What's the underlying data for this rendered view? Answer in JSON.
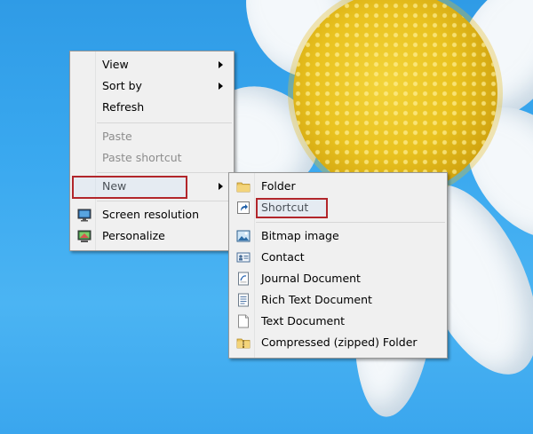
{
  "context_menu": {
    "items": [
      {
        "label": "View",
        "has_submenu": true,
        "enabled": true
      },
      {
        "label": "Sort by",
        "has_submenu": true,
        "enabled": true
      },
      {
        "label": "Refresh",
        "has_submenu": false,
        "enabled": true
      },
      {
        "label": "Paste",
        "has_submenu": false,
        "enabled": false
      },
      {
        "label": "Paste shortcut",
        "has_submenu": false,
        "enabled": false
      },
      {
        "label": "New",
        "has_submenu": true,
        "enabled": true,
        "highlighted": true
      },
      {
        "label": "Screen resolution",
        "has_submenu": false,
        "enabled": true,
        "icon": "monitor-icon"
      },
      {
        "label": "Personalize",
        "has_submenu": false,
        "enabled": true,
        "icon": "personalize-icon"
      }
    ]
  },
  "new_submenu": {
    "items": [
      {
        "label": "Folder",
        "icon": "folder-icon"
      },
      {
        "label": "Shortcut",
        "icon": "shortcut-icon",
        "highlighted": true
      },
      {
        "label": "Bitmap image",
        "icon": "bitmap-image-icon"
      },
      {
        "label": "Contact",
        "icon": "contact-icon"
      },
      {
        "label": "Journal Document",
        "icon": "journal-document-icon"
      },
      {
        "label": "Rich Text Document",
        "icon": "rich-text-document-icon"
      },
      {
        "label": "Text Document",
        "icon": "text-document-icon"
      },
      {
        "label": "Compressed (zipped) Folder",
        "icon": "zipped-folder-icon"
      }
    ]
  },
  "colors": {
    "highlight_border": "#b2262b",
    "menu_background": "#f0f0f0",
    "disabled_text": "#8d8d8d",
    "desktop_blue": "#39a8ef"
  }
}
